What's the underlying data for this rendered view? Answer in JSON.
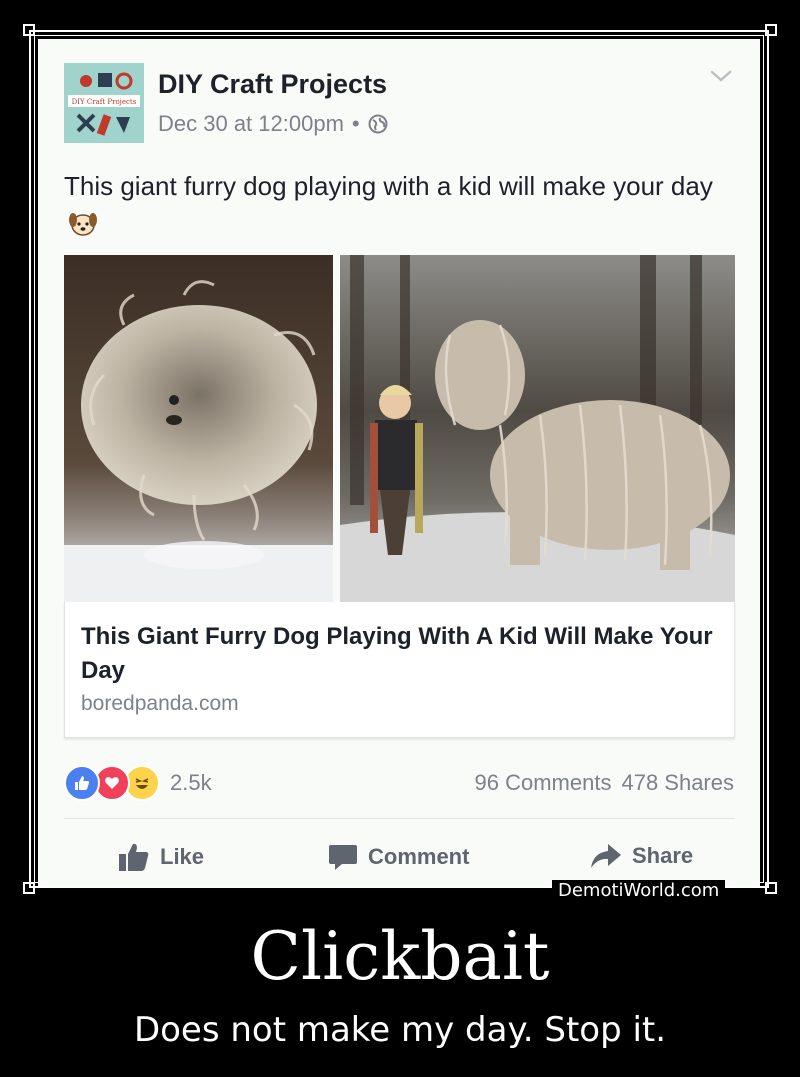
{
  "post": {
    "page_name": "DIY Craft Projects",
    "avatar_text": "DIY Craft Projects",
    "timestamp": "Dec 30 at 12:00pm",
    "separator": "•",
    "text": "This giant furry dog playing with a kid will make your day",
    "link": {
      "title": "This Giant Furry Dog Playing With A Kid Will Make Your Day",
      "domain": "boredpanda.com"
    },
    "reaction_count": "2.5k",
    "comments": "96 Comments",
    "shares": "478 Shares",
    "actions": {
      "like": "Like",
      "comment": "Comment",
      "share": "Share"
    },
    "icons": [
      "globe-icon",
      "chevron-down-icon",
      "dog-emoji-icon",
      "like-reaction-icon",
      "love-reaction-icon",
      "haha-reaction-icon",
      "thumbs-up-icon",
      "comment-bubble-icon",
      "share-arrow-icon"
    ]
  },
  "poster": {
    "watermark": "DemotiWorld.com",
    "title": "Clickbait",
    "subtitle": "Does not make my day. Stop it."
  },
  "colors": {
    "like_blue": "#4a80f0",
    "love_red": "#f0405a",
    "haha_yellow": "#fcd34a",
    "text_dark": "#1d2129",
    "text_muted": "#7d828a"
  }
}
